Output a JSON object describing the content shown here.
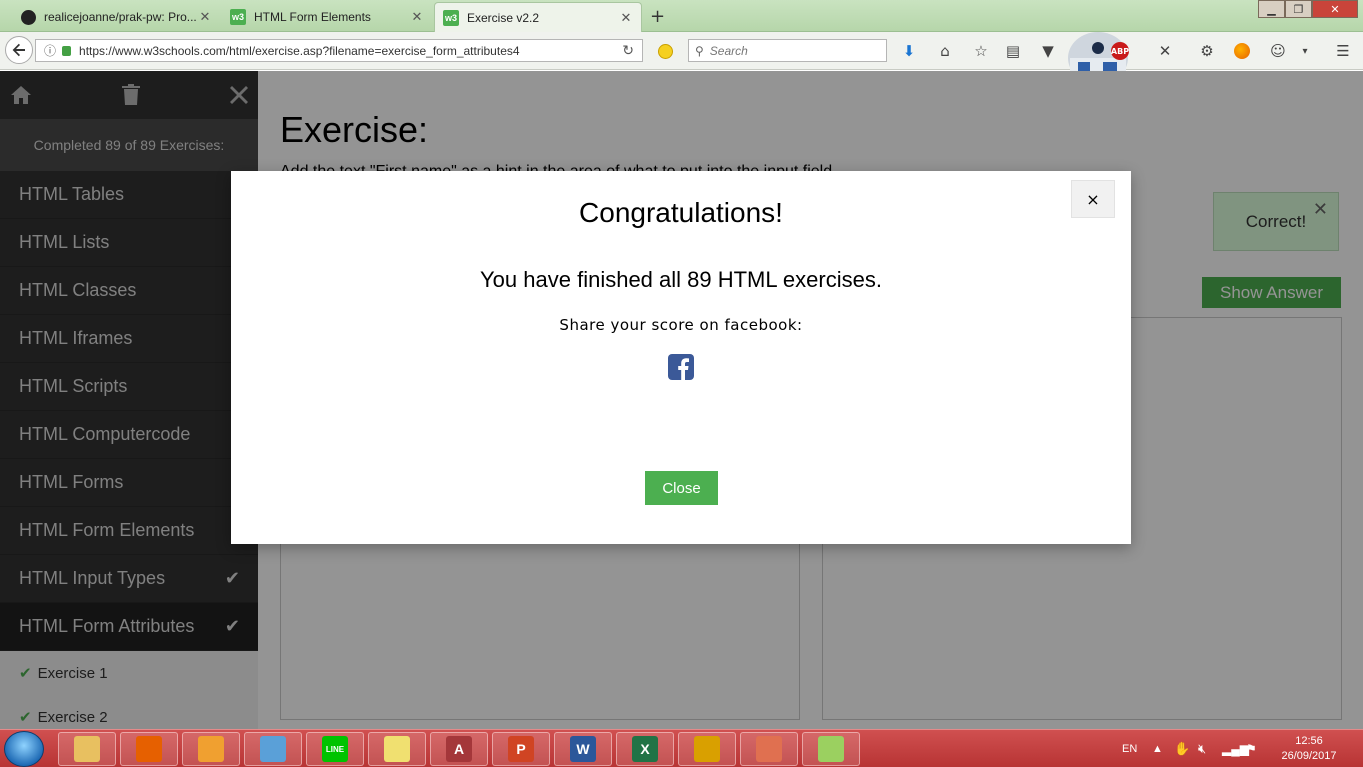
{
  "browser": {
    "tabs": [
      {
        "label": "realicejoanne/prak-pw: Pro...",
        "icon": "github-icon",
        "active": false
      },
      {
        "label": "HTML Form Elements",
        "icon": "w3schools-icon",
        "active": false
      },
      {
        "label": "Exercise v2.2",
        "icon": "w3schools-icon",
        "active": true
      }
    ],
    "new_tab_label": "+",
    "url": "https://www.w3schools.com/html/exercise.asp?filename=exercise_form_attributes4",
    "search_placeholder": "Search",
    "adblock_badge": "ABP"
  },
  "sidebar": {
    "completed_text": "Completed 89 of 89 Exercises:",
    "items": [
      {
        "label": "HTML Tables",
        "state": "collapsed"
      },
      {
        "label": "HTML Lists",
        "state": "collapsed"
      },
      {
        "label": "HTML Classes",
        "state": "collapsed"
      },
      {
        "label": "HTML Iframes",
        "state": "collapsed"
      },
      {
        "label": "HTML Scripts",
        "state": "collapsed"
      },
      {
        "label": "HTML Computercode",
        "state": "collapsed"
      },
      {
        "label": "HTML Forms",
        "state": "collapsed"
      },
      {
        "label": "HTML Form Elements",
        "state": "collapsed"
      },
      {
        "label": "HTML Input Types",
        "state": "done"
      },
      {
        "label": "HTML Form Attributes",
        "state": "done"
      }
    ],
    "sub_items": [
      {
        "label": "Exercise 1"
      },
      {
        "label": "Exercise 2"
      }
    ]
  },
  "main": {
    "heading": "Exercise:",
    "instruction": "Add the text \"First name\" as a hint in the area of what to put into the input field.",
    "correct_text": "Correct!",
    "show_answer_label": "Show Answer"
  },
  "modal": {
    "close_x": "×",
    "title": "Congratulations!",
    "message": "You have finished all 89 HTML exercises.",
    "share_text": "Share your score on facebook:",
    "close_label": "Close"
  },
  "taskbar": {
    "apps": [
      {
        "name": "file-explorer-icon",
        "letter": "",
        "color": "#e8c060"
      },
      {
        "name": "firefox-icon",
        "letter": "",
        "color": "#e66000"
      },
      {
        "name": "media-player-icon",
        "letter": "",
        "color": "#f0a030"
      },
      {
        "name": "computer-icon",
        "letter": "",
        "color": "#5aa0d8"
      },
      {
        "name": "line-icon",
        "letter": "LINE",
        "color": "#00c300"
      },
      {
        "name": "sticky-notes-icon",
        "letter": "",
        "color": "#f0e070"
      },
      {
        "name": "access-icon",
        "letter": "A",
        "color": "#a4373a"
      },
      {
        "name": "powerpoint-icon",
        "letter": "P",
        "color": "#d04423"
      },
      {
        "name": "word-icon",
        "letter": "W",
        "color": "#2b579a"
      },
      {
        "name": "excel-icon",
        "letter": "X",
        "color": "#217346"
      },
      {
        "name": "winrar-icon",
        "letter": "",
        "color": "#d9a000"
      },
      {
        "name": "app-icon",
        "letter": "",
        "color": "#e07050"
      },
      {
        "name": "notepad-plus-icon",
        "letter": "",
        "color": "#9bd060"
      }
    ],
    "language": "EN",
    "time": "12:56",
    "date": "26/09/2017"
  },
  "colors": {
    "accent": "#4CAF50",
    "sidebar_bg": "#2d2d2d",
    "taskbar": "#c84040",
    "facebook": "#3b5998"
  }
}
